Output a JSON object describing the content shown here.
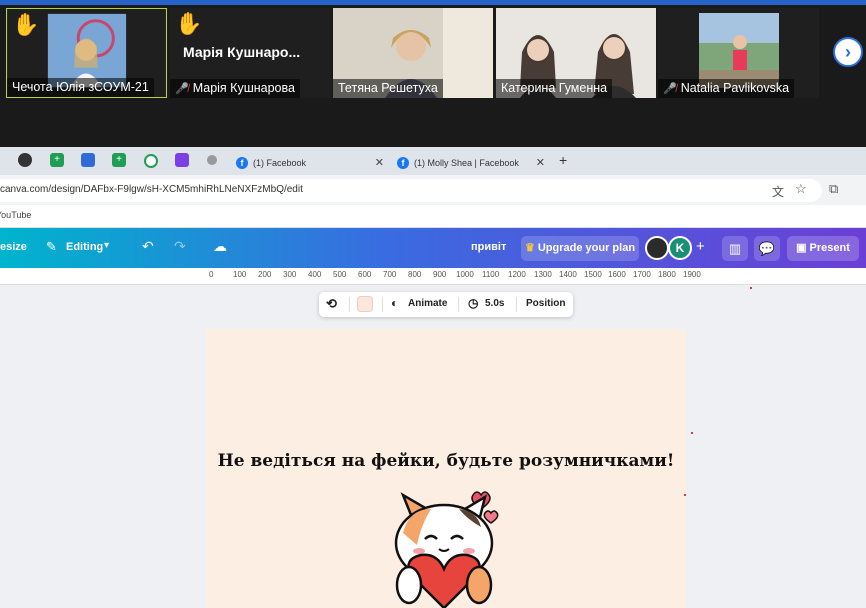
{
  "call": {
    "participants": [
      {
        "name": "Чечота Юлія зСОУМ-21",
        "muted": false,
        "hand_raised": true
      },
      {
        "name": "Марія Кушнарова",
        "muted": true,
        "hand_raised": true,
        "display_label": "Марія Кушнаро..."
      },
      {
        "name": "Тетяна Решетуха",
        "muted": false,
        "hand_raised": false
      },
      {
        "name": "Катерина Гуменна",
        "muted": false,
        "hand_raised": false
      },
      {
        "name": "Natalia Pavlikovska",
        "muted": true,
        "hand_raised": false
      }
    ]
  },
  "browser": {
    "tabs": [
      {
        "title": "(1) Facebook"
      },
      {
        "title": "(1) Molly Shea | Facebook"
      }
    ],
    "new_tab": "+",
    "url": "canva.com/design/DAFbx-F9lgw/sH-XCM5mhiRhLNeNXFzMbQ/edit",
    "bookmark": "YouTube"
  },
  "canva": {
    "resize_label": "esize",
    "editing_label": "Editing",
    "title": "привіт",
    "upgrade_label": "Upgrade your plan",
    "avatar_letter": "K",
    "present_label": "Present",
    "ruler": [
      "0",
      "100",
      "200",
      "300",
      "400",
      "500",
      "600",
      "700",
      "800",
      "900",
      "1000",
      "1100",
      "1200",
      "1300",
      "1400",
      "1500",
      "1600",
      "1700",
      "1800",
      "1900"
    ],
    "floating_toolbar": {
      "animate": "Animate",
      "duration": "5.0s",
      "position": "Position"
    },
    "headline": "Не ведіться на фейки, будьте розумничками!"
  },
  "colors": {
    "accent": "#2a6fe0",
    "page_bg": "#fdeee4"
  }
}
